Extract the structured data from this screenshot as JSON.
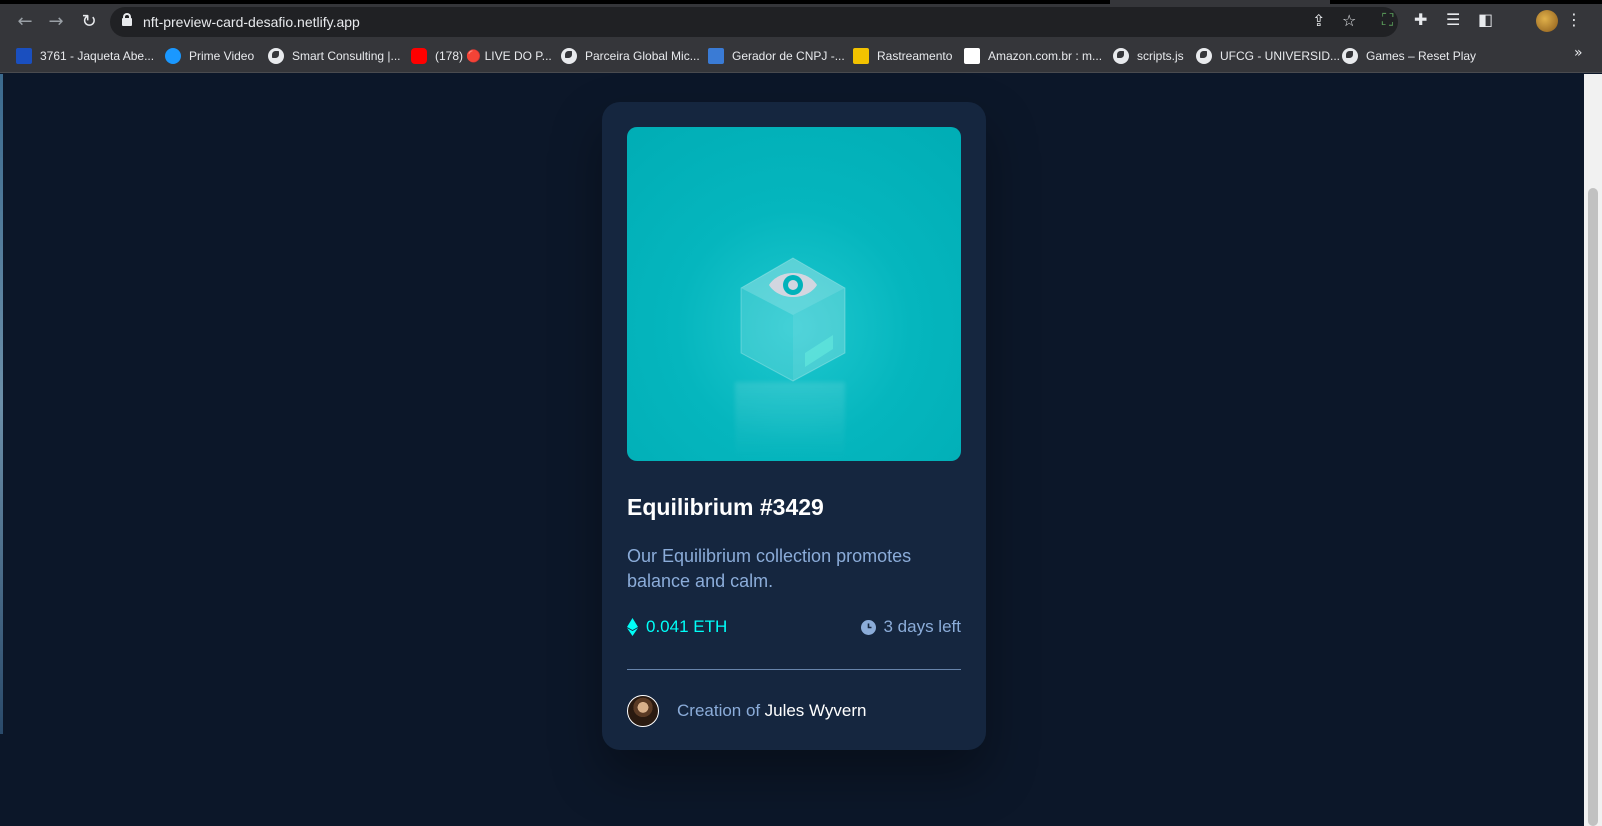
{
  "browser": {
    "url": "nft-preview-card-desafio.netlify.app",
    "bookmarks": [
      {
        "label": "3761 - Jaqueta Abe...",
        "icon": "r-logo-icon",
        "color": "#1a4fbf"
      },
      {
        "label": "Prime Video",
        "icon": "prime-video-icon",
        "color": "#1a98ff"
      },
      {
        "label": "Smart Consulting |...",
        "icon": "globe-icon",
        "color": "#e8eaed"
      },
      {
        "label": "(178) 🔴 LIVE DO P...",
        "icon": "youtube-icon",
        "color": "#ff0000"
      },
      {
        "label": "Parceira Global Mic...",
        "icon": "globe-icon",
        "color": "#e8eaed"
      },
      {
        "label": "Gerador de CNPJ -...",
        "icon": "cnpj-icon",
        "color": "#3a7bd5"
      },
      {
        "label": "Rastreamento",
        "icon": "tracking-icon",
        "color": "#f2c200"
      },
      {
        "label": "Amazon.com.br : m...",
        "icon": "amazon-icon",
        "color": "#ffffff"
      },
      {
        "label": "scripts.js",
        "icon": "globe-icon",
        "color": "#e8eaed"
      },
      {
        "label": "UFCG - UNIVERSID...",
        "icon": "globe-icon",
        "color": "#e8eaed"
      },
      {
        "label": "Games – Reset Play",
        "icon": "globe-icon",
        "color": "#e8eaed"
      }
    ]
  },
  "card": {
    "title": "Equilibrium #3429",
    "description": "Our Equilibrium collection promotes balance and calm.",
    "price": "0.041 ETH",
    "time_left": "3 days left",
    "creator_prefix": "Creation of",
    "creator_name": "Jules Wyvern"
  },
  "colors": {
    "page_bg": "#0c1729",
    "card_bg": "#15263f",
    "cyan": "#00fff8",
    "soft_blue": "#8bacd9",
    "hero_bg": "#00adb5"
  }
}
